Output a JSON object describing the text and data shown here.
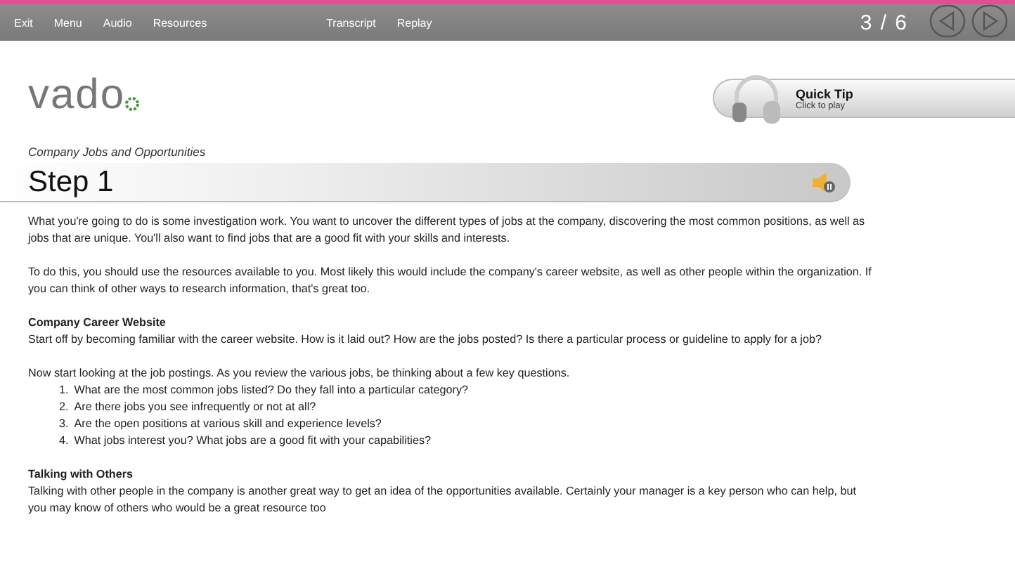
{
  "menu": [
    {
      "label": "Exit"
    },
    {
      "label": "Menu"
    },
    {
      "label": "Audio"
    },
    {
      "label": "Resources"
    },
    {
      "label": "Transcript"
    },
    {
      "label": "Replay"
    }
  ],
  "page_counter": "3 / 6",
  "logo": {
    "text": "vado"
  },
  "quick_tip": {
    "title": "Quick Tip",
    "subtitle": "Click to play"
  },
  "subtitle": "Company Jobs and Opportunities",
  "step_title": "Step 1",
  "content": [
    {
      "kind": "paragraph",
      "text": "What you're going to do is some investigation work. You want to uncover the different types of jobs at the company, discovering the most common positions, as well as jobs that are unique. You'll also want to find jobs that are a good fit with your skills and interests."
    },
    {
      "kind": "paragraph",
      "text": "To do this, you should use the resources available to you. Most likely this would include the company's career website, as well as other people within the organization. If you can think of other ways to research information, that's great too."
    },
    {
      "kind": "heading",
      "text": "Company Career Website"
    },
    {
      "kind": "paragraph",
      "text": "Start off by becoming familiar with the career website. How is it laid out? How are the jobs posted? Is there a particular process or guideline to apply for a job?"
    },
    {
      "kind": "paragraph",
      "text": "Now start looking at the job postings. As you review the various jobs, be thinking about a few key questions."
    },
    {
      "kind": "list",
      "items": [
        {
          "number": "1.",
          "text": "What are the most common jobs listed? Do they fall into a particular category?"
        },
        {
          "number": "2.",
          "text": "Are there jobs you see infrequently or not at all?"
        },
        {
          "number": "3.",
          "text": "Are the open positions at various skill and experience levels?"
        },
        {
          "number": "4.",
          "text": "What jobs interest you? What jobs are a good fit with your capabilities?"
        }
      ]
    },
    {
      "kind": "heading",
      "text": "Talking with Others"
    },
    {
      "kind": "paragraph",
      "text": "Talking with other people in the company is another great way to get an idea of the opportunities available. Certainly your manager is a key person who can help, but you may know of others who would be a great resource too"
    }
  ]
}
